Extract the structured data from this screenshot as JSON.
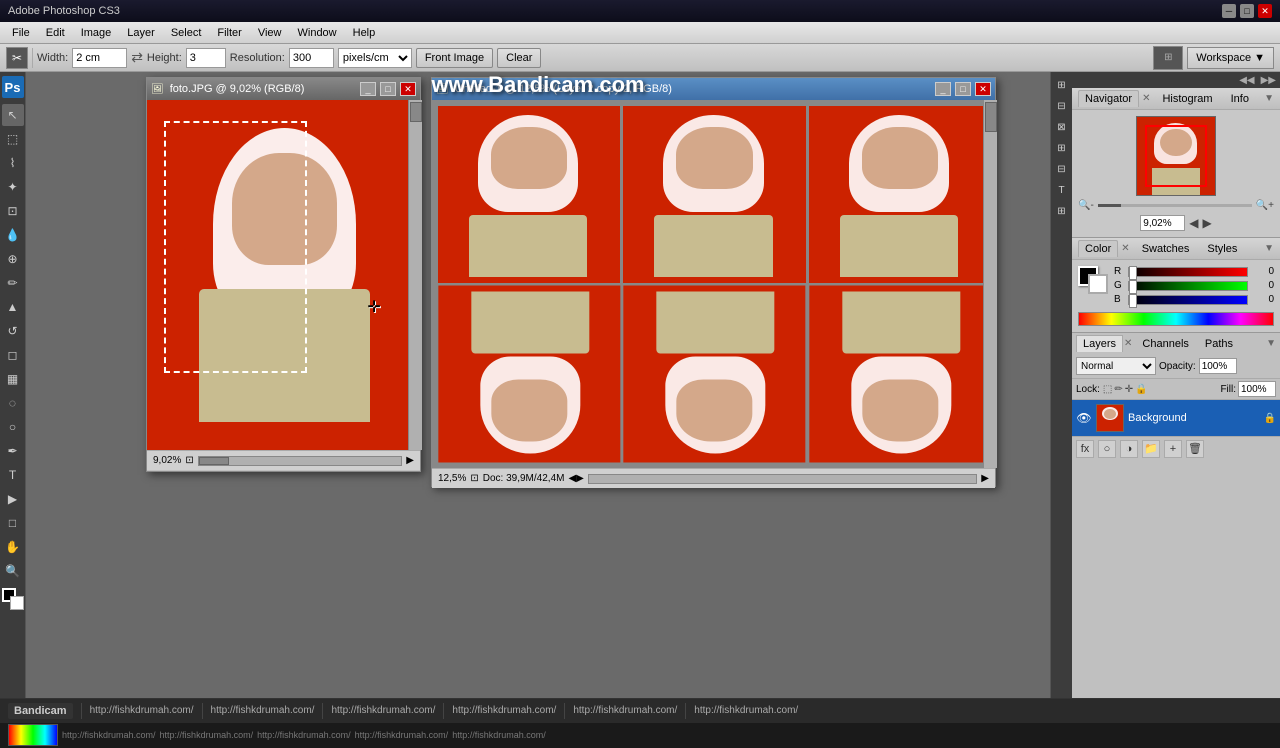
{
  "app": {
    "title": "Adobe Photoshop CS3",
    "bandicam_url": "www.Bandicam.com"
  },
  "menu": {
    "items": [
      "File",
      "Edit",
      "Image",
      "Layer",
      "Select",
      "Filter",
      "View",
      "Window",
      "Help"
    ]
  },
  "toolbar": {
    "width_label": "Width:",
    "width_value": "2 cm",
    "height_label": "Height:",
    "height_value": "3",
    "resolution_label": "Resolution:",
    "resolution_value": "300",
    "resolution_unit": "pixels/cm",
    "front_image_btn": "Front Image",
    "clear_btn": "Clear",
    "workspace_btn": "Workspace"
  },
  "doc1": {
    "title": "foto.JPG @ 9,02% (RGB/8)",
    "zoom": "9,02%"
  },
  "doc2": {
    "title": "Untitled-1 @ 12,5% (Layer 2 copy 2, RGB/8)",
    "zoom": "12,5%",
    "doc_info": "Doc: 39,9M/42,4M"
  },
  "navigator": {
    "tab": "Navigator",
    "histogram_tab": "Histogram",
    "info_tab": "Info",
    "zoom_value": "9,02%"
  },
  "color_panel": {
    "tab": "Color",
    "swatches_tab": "Swatches",
    "styles_tab": "Styles",
    "r_label": "R",
    "g_label": "G",
    "b_label": "B",
    "r_value": "0",
    "g_value": "0",
    "b_value": "0"
  },
  "layers_panel": {
    "layers_tab": "Layers",
    "channels_tab": "Channels",
    "paths_tab": "Paths",
    "blend_mode": "Normal",
    "opacity_label": "Opacity:",
    "opacity_value": "100%",
    "lock_label": "Lock:",
    "fill_label": "Fill:",
    "fill_value": "100%",
    "background_layer": "Background"
  },
  "taskbar": {
    "app_name": "Bandicam",
    "url1": "http://fishkdrumah.com/",
    "url2": "http://fishkdrumah.com/",
    "url3": "http://fishkdrumah.com/",
    "url4": "http://fishkdrumah.com/",
    "url5": "http://fishkdrumah.com/"
  }
}
